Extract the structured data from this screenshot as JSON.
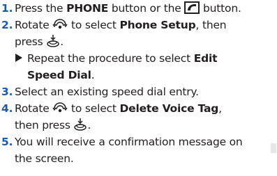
{
  "steps": [
    {
      "num": "1.",
      "pre": "Press the ",
      "bold1": "PHONE",
      "mid": " button or the ",
      "icon": "phone-button-icon",
      "post": " button."
    },
    {
      "num": "2.",
      "pre": "Rotate ",
      "icon": "rotary-dial-icon",
      "mid": " to select ",
      "bold1": "Phone Setup",
      "post": ", then"
    },
    {
      "cont": "press ",
      "icon": "press-enter-icon",
      "post": "."
    },
    {
      "sub_pre": "Repeat the procedure to select ",
      "sub_bold": "Edit",
      "sub_bold2": "Speed Dial",
      "sub_post": "."
    },
    {
      "num": "3.",
      "text": "Select an existing speed dial entry."
    },
    {
      "num": "4.",
      "pre": "Rotate ",
      "icon": "rotary-dial-icon",
      "mid": " to select ",
      "bold1": "Delete Voice Tag",
      "post": ","
    },
    {
      "cont": "then press ",
      "icon": "press-enter-icon",
      "post": "."
    },
    {
      "num": "5.",
      "text": "You will receive a confirmation message on",
      "text2": "the screen."
    }
  ],
  "colors": {
    "number": "#1e5aa8",
    "text": "#231f20"
  }
}
